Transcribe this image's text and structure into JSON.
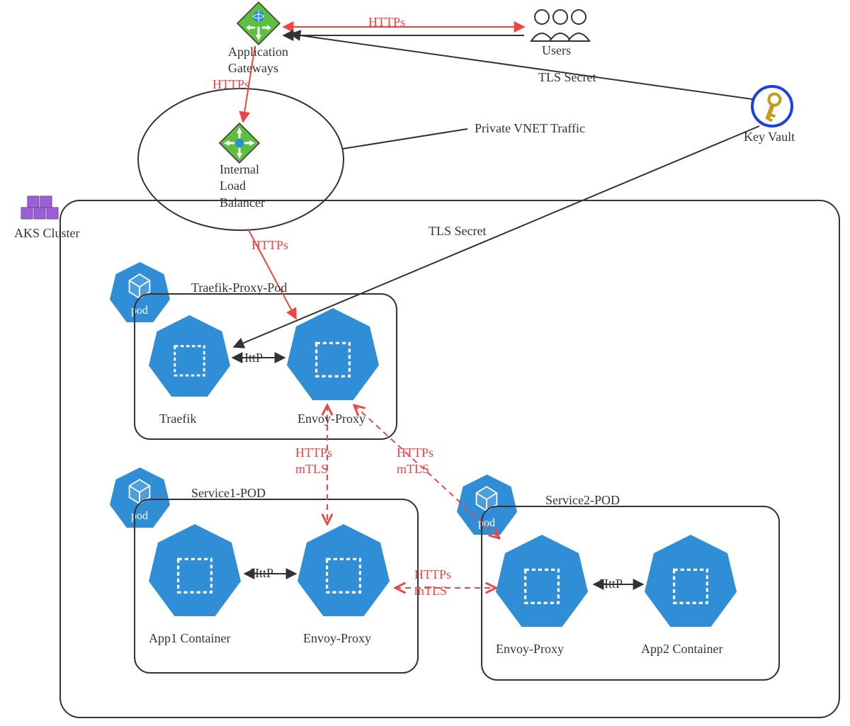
{
  "nodes": {
    "appGateway": {
      "label": "Application\nGateways"
    },
    "users": {
      "label": "Users"
    },
    "keyVault": {
      "label": "Key Vault"
    },
    "ilb": {
      "label": "Internal\nLoad\nBalancer"
    },
    "aksCluster": {
      "label": "AKS Cluster"
    },
    "traefikPod": {
      "label": "Traefik-Proxy-Pod"
    },
    "traefik": {
      "label": "Traefik"
    },
    "envoyTop": {
      "label": "Envoy-Proxy"
    },
    "service1Pod": {
      "label": "Service1-POD"
    },
    "app1": {
      "label": "App1 Container"
    },
    "envoyL": {
      "label": "Envoy-Proxy"
    },
    "service2Pod": {
      "label": "Service2-POD"
    },
    "envoyR": {
      "label": "Envoy-Proxy"
    },
    "app2": {
      "label": "App2 Container"
    }
  },
  "edges": {
    "users_to_appgw": {
      "label": "HTTPs"
    },
    "appgw_to_ilb": {
      "label": "HTTPs"
    },
    "ilb_to_traefik": {
      "label": "HTTPs"
    },
    "kv_to_appgw": {
      "label": "TLS Secret"
    },
    "kv_to_traefik": {
      "label": "TLS Secret"
    },
    "ilb_vnet": {
      "label": "Private VNET Traffic"
    },
    "traefik_http": {
      "label": "HttP"
    },
    "envoyTop_to_s1": {
      "label": "HTTPs\nmTLS"
    },
    "envoyTop_to_s2": {
      "label": "HTTPs\nmTLS"
    },
    "s1_http": {
      "label": "HttP"
    },
    "s1_to_s2": {
      "label": "HTTPs\nmTLS"
    },
    "s2_http": {
      "label": "HttP"
    }
  },
  "colors": {
    "azureBlue": "#2d8cd6",
    "azureGreen": "#5cbf3e",
    "outline": "#333333",
    "red": "#ee4444",
    "podFill": "#2f8ed6",
    "purple": "#9a60d4",
    "keyBlue": "#1f3fe0",
    "keyGold": "#c89a1a"
  }
}
